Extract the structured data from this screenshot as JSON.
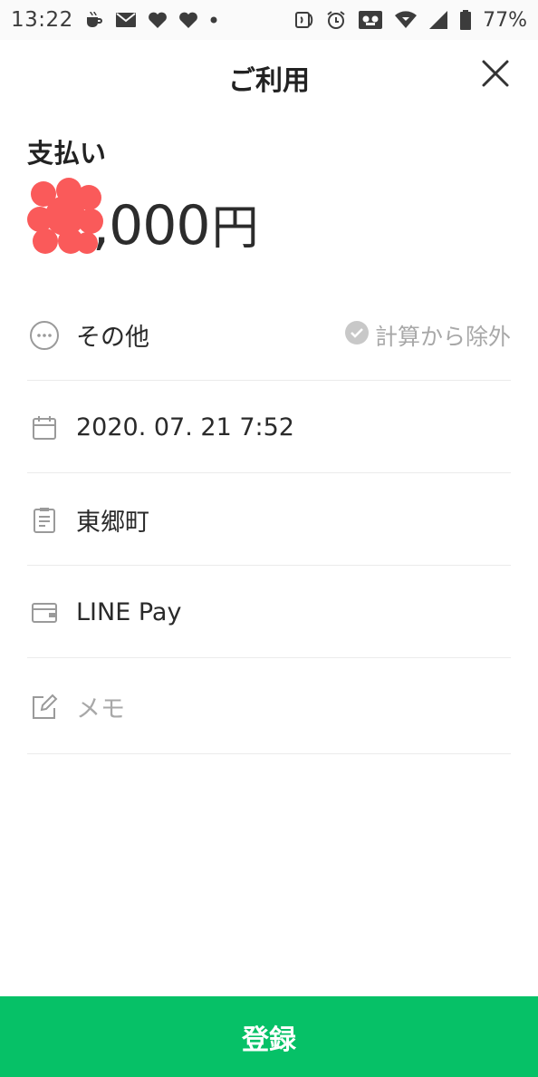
{
  "status_bar": {
    "time": "13:22",
    "left_icons": [
      "coffee-cup-icon",
      "mail-icon",
      "heart-icon",
      "heart-icon",
      "dot-icon"
    ],
    "right_icons": [
      "nfc-icon",
      "alarm-icon",
      "voicemail-icon",
      "wifi-icon",
      "signal-icon",
      "battery-icon"
    ],
    "battery": "77%"
  },
  "header": {
    "title": "ご利用",
    "close_icon": "close-icon"
  },
  "payment": {
    "label": "支払い",
    "amount_visible": ",000",
    "currency": "円"
  },
  "rows": {
    "category": {
      "icon": "more-circle-icon",
      "label": "その他"
    },
    "exclude": {
      "icon": "check-circle-icon",
      "label": "計算から除外"
    },
    "date": {
      "icon": "calendar-icon",
      "value": "2020. 07. 21 7:52"
    },
    "store": {
      "icon": "receipt-icon",
      "value": "東郷町"
    },
    "payment_method": {
      "icon": "wallet-icon",
      "value": "LINE Pay"
    },
    "memo": {
      "icon": "edit-icon",
      "placeholder": "メモ"
    }
  },
  "footer": {
    "submit_label": "登録"
  },
  "colors": {
    "accent_green": "#06c167",
    "redaction": "#fa5a5a",
    "muted_text": "#a8a8a8",
    "divider": "#ebebeb"
  }
}
